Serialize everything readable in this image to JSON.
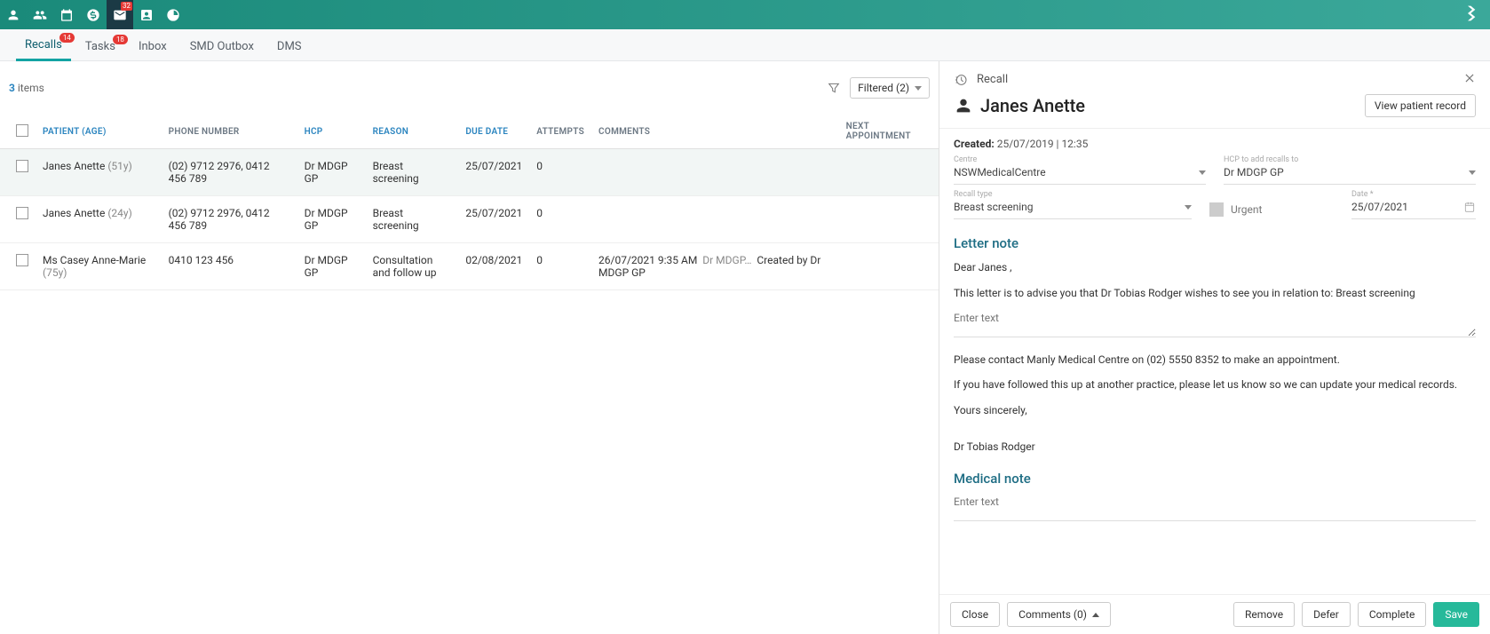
{
  "topbar": {
    "mail_badge": "32"
  },
  "tabs": [
    {
      "label": "Recalls",
      "badge": "14",
      "active": true
    },
    {
      "label": "Tasks",
      "badge": "18"
    },
    {
      "label": "Inbox"
    },
    {
      "label": "SMD Outbox"
    },
    {
      "label": "DMS"
    }
  ],
  "items_count": "3",
  "items_word": "items",
  "filter_label": "Filtered (2)",
  "columns": {
    "patient": "PATIENT",
    "age": "(AGE)",
    "phone": "PHONE NUMBER",
    "hcp": "HCP",
    "reason": "REASON",
    "due": "DUE DATE",
    "attempts": "ATTEMPTS",
    "comments": "COMMENTS",
    "next": "NEXT APPOINTMENT"
  },
  "rows": [
    {
      "patient": "Janes Anette",
      "age": "(51y)",
      "phone": "(02) 9712 2976, 0412 456 789",
      "hcp": "Dr MDGP GP",
      "reason": "Breast screening",
      "due": "25/07/2021",
      "attempts": "0",
      "comments_date": "",
      "comments_who": "",
      "comments_text": "",
      "next": "",
      "selected": true
    },
    {
      "patient": "Janes Anette",
      "age": "(24y)",
      "phone": "(02) 9712 2976, 0412 456 789",
      "hcp": "Dr MDGP GP",
      "reason": "Breast screening",
      "due": "25/07/2021",
      "attempts": "0",
      "comments_date": "",
      "comments_who": "",
      "comments_text": "",
      "next": ""
    },
    {
      "patient": "Ms Casey Anne-Marie",
      "age": "(75y)",
      "phone": "0410 123 456",
      "hcp": "Dr MDGP GP",
      "reason": "Consultation and follow up",
      "due": "02/08/2021",
      "attempts": "0",
      "comments_date": "26/07/2021 9:35 AM",
      "comments_who": "Dr MDGP…",
      "comments_text": "Created by Dr MDGP GP",
      "next": ""
    }
  ],
  "detail": {
    "header_label": "Recall",
    "patient_name": "Janes Anette",
    "view_record": "View patient record",
    "created_label": "Created:",
    "created_value": "25/07/2019 | 12:35",
    "centre_label": "Centre",
    "centre_value": "NSWMedicalCentre",
    "hcp_label": "HCP to add recalls to",
    "hcp_value": "Dr MDGP GP",
    "recall_type_label": "Recall type",
    "recall_type_value": "Breast screening",
    "urgent_label": "Urgent",
    "date_label": "Date *",
    "date_value": "25/07/2021",
    "letter_title": "Letter note",
    "letter_greeting": "Dear Janes ,",
    "letter_body1": "This letter is to advise you that Dr Tobias Rodger wishes to see you in relation to: Breast screening",
    "letter_ph": "Enter text",
    "letter_body2": "Please contact Manly Medical Centre on (02) 5550 8352 to make an appointment.",
    "letter_body3": "If you have followed this up at another practice, please let us know so we can update your medical records.",
    "letter_signoff": "Yours sincerely,",
    "letter_signer": "Dr Tobias Rodger",
    "medical_title": "Medical note",
    "medical_ph": "Enter text",
    "btn_close": "Close",
    "btn_comments": "Comments (0)",
    "btn_remove": "Remove",
    "btn_defer": "Defer",
    "btn_complete": "Complete",
    "btn_save": "Save"
  }
}
